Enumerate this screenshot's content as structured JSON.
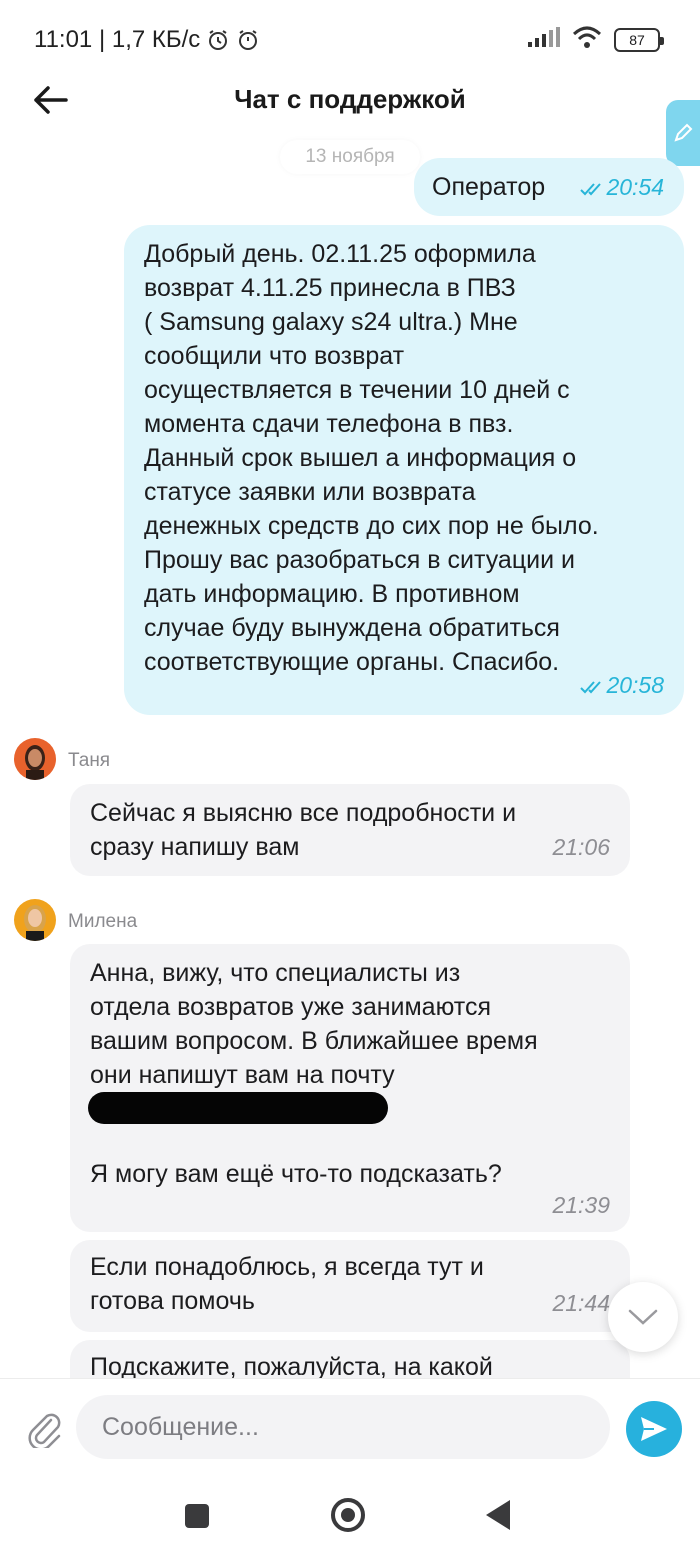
{
  "status_bar": {
    "time_speed": "11:01 | 1,7 КБ/с",
    "battery": "87",
    "icons": [
      "alarm-icon",
      "alarm-clock-icon",
      "signal-icon",
      "wifi-icon",
      "battery-icon"
    ]
  },
  "header": {
    "title": "Чат с поддержкой",
    "back_icon": "arrow-left-icon",
    "edit_icon": "pencil-icon"
  },
  "date_separator": "13 ноября",
  "messages": [
    {
      "direction": "out",
      "text": "Оператор",
      "time": "20:54",
      "status": "read"
    },
    {
      "direction": "out",
      "text": "Добрый день. 02.11.25 оформила\nвозврат 4.11.25 принесла в ПВЗ\n( Samsung galaxy s24 ultra.)  Мне\nсообщили что возврат\nосуществляется в течении 10 дней с\nмомента сдачи телефона в пвз.\nДанный срок вышел а информация о\nстатусе заявки или возврата\nденежных средств до сих пор не было.\nПрошу вас разобраться в ситуации и\nдать информацию. В противном\nслучае буду вынуждена обратиться\nсоответствующие органы. Спасибо.",
      "time": "20:58",
      "status": "read"
    },
    {
      "direction": "in",
      "sender": "Таня",
      "text": "Сейчас я выясню все подробности и\nсразу напишу вам",
      "time": "21:06"
    },
    {
      "direction": "in",
      "sender": "Милена",
      "text": "Анна, вижу, что специалисты из\nотдела возвратов уже занимаются\nвашим вопросом. В ближайшее время\nони напишут вам на почту",
      "text_after": "Я могу вам ещё что-то подсказать?",
      "redacted": true,
      "time": "21:39"
    },
    {
      "direction": "in",
      "sender": "Милена",
      "text": "Если понадоблюсь, я всегда тут и\nготова помочь",
      "time": "21:44"
    },
    {
      "direction": "in",
      "sender": "Милена",
      "text": "Подскажите, пожалуйста, на какой"
    }
  ],
  "input": {
    "placeholder": "Сообщение...",
    "attach_icon": "paperclip-icon",
    "send_icon": "send-icon"
  },
  "navbar": {
    "icons": [
      "recents-icon",
      "home-icon",
      "back-triangle-icon"
    ]
  },
  "colors": {
    "outgoing_bubble": "#def5fb",
    "incoming_bubble": "#f3f3f5",
    "accent": "#27b1dd",
    "time_outgoing": "#27b5d8"
  }
}
